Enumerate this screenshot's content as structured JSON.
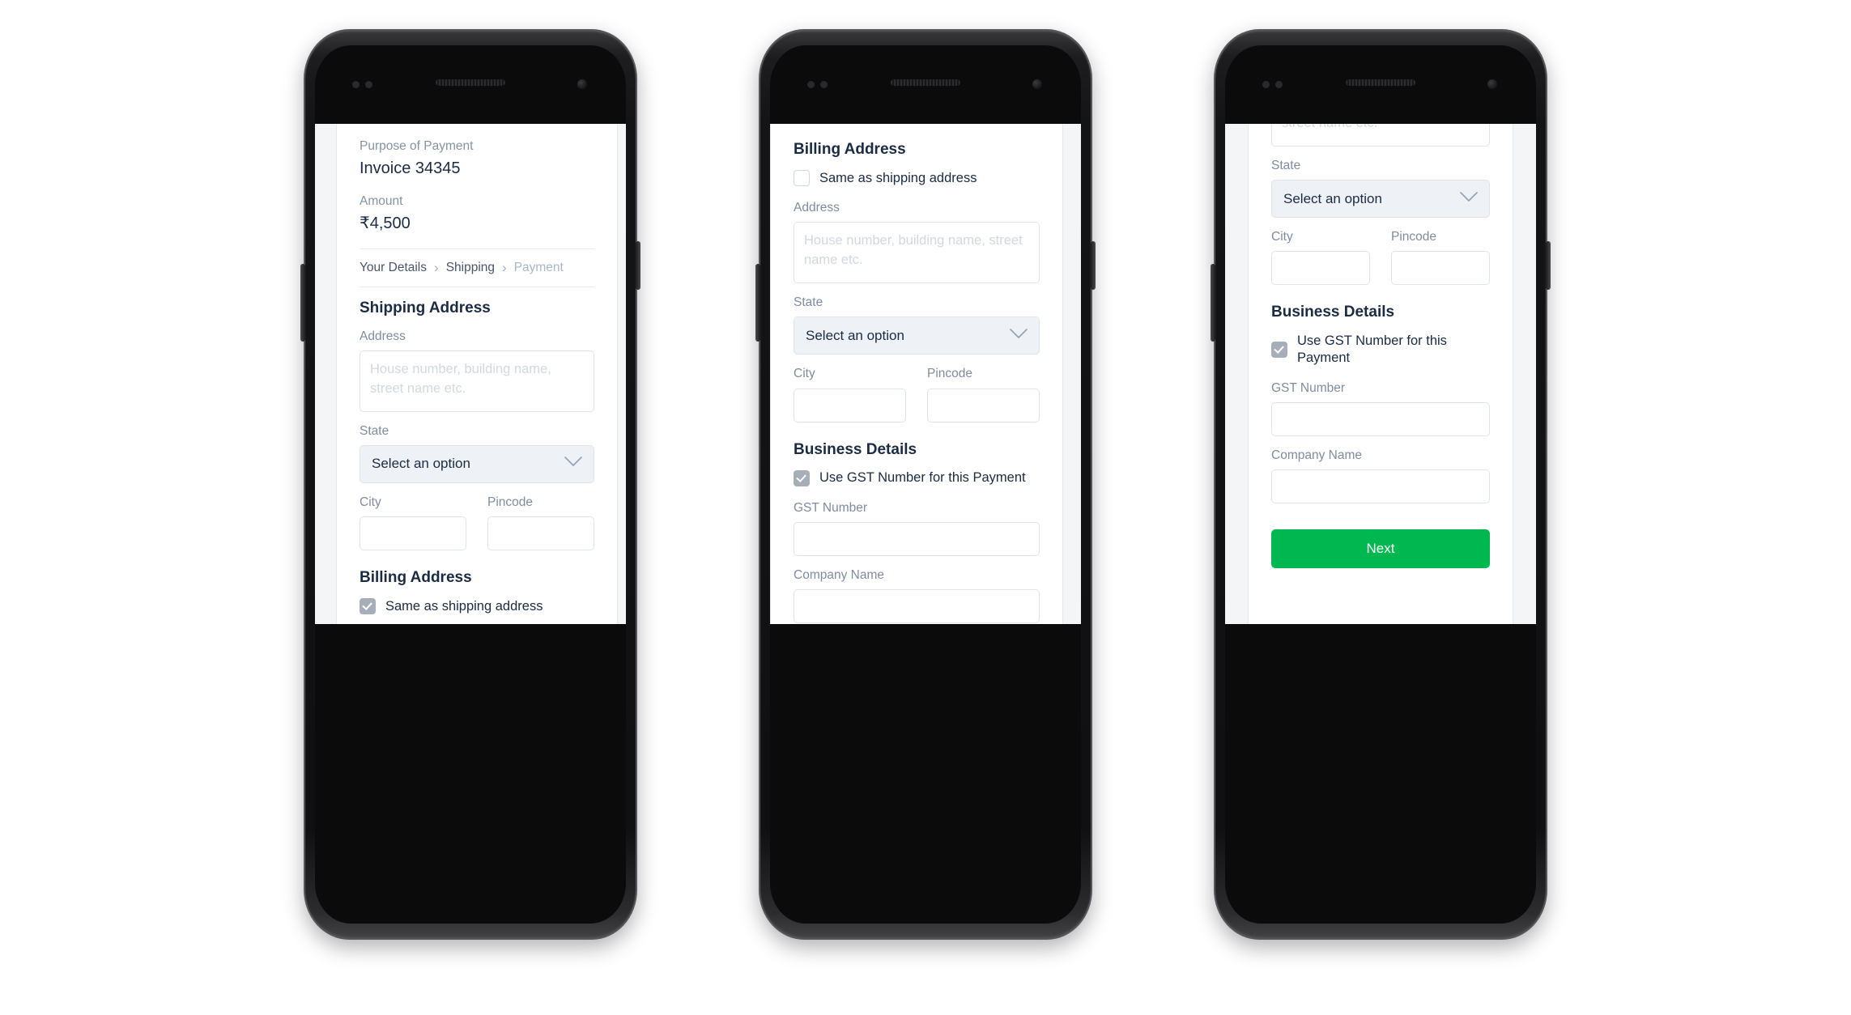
{
  "brand": {
    "accent_green": "#00b84f",
    "text_dark": "#1a2b42",
    "text_muted": "#8792a2",
    "select_fill": "#eef2f6",
    "checkbox_checked": "#a6aeb9"
  },
  "labels": {
    "purpose_label": "Purpose of Payment",
    "purpose_value": "Invoice 34345",
    "amount_label": "Amount",
    "amount_value": "₹4,500",
    "address_label": "Address",
    "address_placeholder": "House number, building name, street name etc.",
    "state_label": "State",
    "state_value": "Select an option",
    "city_label": "City",
    "city_value": "",
    "pincode_label": "Pincode",
    "pincode_value": "",
    "gst_label": "GST Number",
    "gst_value": "",
    "company_label": "Company Name",
    "company_value": "",
    "shipping_title": "Shipping Address",
    "billing_title": "Billing Address",
    "business_title": "Business Details",
    "same_as_shipping": "Same as shipping address",
    "use_gst": "Use GST Number for this Payment",
    "next_button": "Next"
  },
  "breadcrumb": {
    "step1": "Your Details",
    "sep1": "›",
    "step2": "Shipping",
    "sep2": "›",
    "step3": "Payment"
  },
  "screens": [
    {
      "id": "screen-shipping",
      "scroll_state": "top",
      "same_as_shipping_checked": true
    },
    {
      "id": "screen-billing",
      "scroll_state": "middle",
      "same_as_shipping_checked": false,
      "use_gst_checked": true
    },
    {
      "id": "screen-business",
      "scroll_state": "bottom",
      "use_gst_checked": true
    }
  ]
}
